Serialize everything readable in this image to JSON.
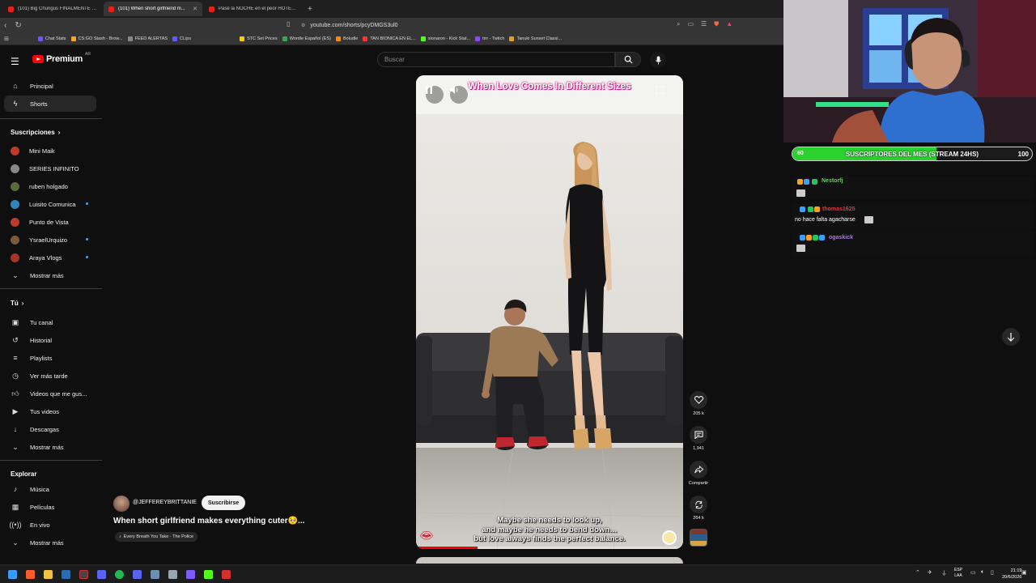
{
  "browser": {
    "tabs": [
      {
        "label": "(101) Big Chungus FINALMENTE RE...",
        "active": false
      },
      {
        "label": "(101) When short girlfriend m...",
        "active": true
      },
      {
        "label": "Pasé la NOCHE en el peor HOTEL de...",
        "active": false
      }
    ],
    "new_tab": "+",
    "url": "youtube.com/shorts/pcyDMGS3ul0",
    "bookmarks": [
      {
        "label": "Chat Stats",
        "color": "#6b58ff"
      },
      {
        "label": "CS:GO Stash - Brow...",
        "color": "#f5a623"
      },
      {
        "label": "FEED ALERTAS",
        "color": "#888888"
      },
      {
        "label": "CLips",
        "color": "#5b5bff"
      },
      {
        "label": "STC Set Prices",
        "color": "#ffcc00"
      },
      {
        "label": "Wordle Español (ES)",
        "color": "#3aa648"
      },
      {
        "label": "Boludle",
        "color": "#ff8800"
      },
      {
        "label": "TAN BIONICA EN EL...",
        "color": "#ff3333"
      },
      {
        "label": "sionaron - Kick Stat...",
        "color": "#53fc18"
      },
      {
        "label": "trrr - Twitch",
        "color": "#9146ff"
      },
      {
        "label": "Tanuki Sunset Classi...",
        "color": "#e0a020"
      }
    ]
  },
  "header": {
    "brand": "Premium",
    "country": "AR",
    "search_placeholder": "Buscar"
  },
  "sidebar": {
    "top": [
      {
        "label": "Principal",
        "icon": "home-icon",
        "active": false
      },
      {
        "label": "Shorts",
        "icon": "shorts-icon",
        "active": true
      }
    ],
    "subscriptions_title": "Suscripciones",
    "subscriptions": [
      {
        "label": "Mini Maik",
        "color": "#c0392b",
        "live": false
      },
      {
        "label": "SERIES INFINITO",
        "color": "#888888",
        "live": false
      },
      {
        "label": "ruben holgado",
        "color": "#5a6b3a",
        "live": false
      },
      {
        "label": "Luisito Comunica",
        "color": "#2e86c1",
        "live": true
      },
      {
        "label": "Punto de Vista",
        "color": "#c0392b",
        "live": false
      },
      {
        "label": "YsraelUrquizo",
        "color": "#7d5a3a",
        "live": true
      },
      {
        "label": "Araya Vlogs",
        "color": "#a93226",
        "live": true
      }
    ],
    "show_more": "Mostrar más",
    "you_title": "Tú",
    "you_items": [
      {
        "label": "Tu canal",
        "icon": "channel-icon"
      },
      {
        "label": "Historial",
        "icon": "history-icon"
      },
      {
        "label": "Playlists",
        "icon": "playlists-icon"
      },
      {
        "label": "Ver más tarde",
        "icon": "watch-later-icon"
      },
      {
        "label": "Videos que me gus...",
        "icon": "like-icon"
      },
      {
        "label": "Tus videos",
        "icon": "your-videos-icon"
      },
      {
        "label": "Descargas",
        "icon": "download-icon"
      }
    ],
    "show_more_2": "Mostrar más",
    "explore_title": "Explorar",
    "explore_items": [
      {
        "label": "Música",
        "icon": "music-icon"
      },
      {
        "label": "Películas",
        "icon": "movies-icon"
      },
      {
        "label": "En vivo",
        "icon": "live-icon"
      }
    ],
    "show_more_3": "Mostrar más"
  },
  "short": {
    "overlay_title": "When Love Comes In Different Sizes",
    "caption_lines": [
      "Maybe she needs to look up,",
      "and maybe he needs to bend down…",
      "but love always finds the perfect balance."
    ],
    "progress": 0.23,
    "channel": "@JEFFEREYBRITTANIE",
    "subscribe": "Suscribirse",
    "title": "When short girlfriend makes everything cuter🥺...",
    "song": "Every Breath You Take · The Police",
    "actions": {
      "likes": "205 k",
      "comments": "1,941",
      "share": "Compartir",
      "remix": "264 k"
    }
  },
  "stream": {
    "goal_current": "60",
    "goal_label": "SUSCRIPTORES DEL MES (STREAM 24HS)",
    "goal_target": "100",
    "goal_fraction": 0.6,
    "chat": [
      {
        "user": "Nestorfj",
        "color": "#5bd45b",
        "message": ""
      },
      {
        "user": "thomas1625",
        "color": "#ff2a2a",
        "message": "no hace falta agacharse"
      },
      {
        "user": "ogaskick",
        "color": "#b66cff",
        "message": ""
      }
    ]
  },
  "taskbar": {
    "lang_top": "ESP",
    "lang_bottom": "LAA",
    "time": "21:19",
    "date": "20/6/2026"
  }
}
